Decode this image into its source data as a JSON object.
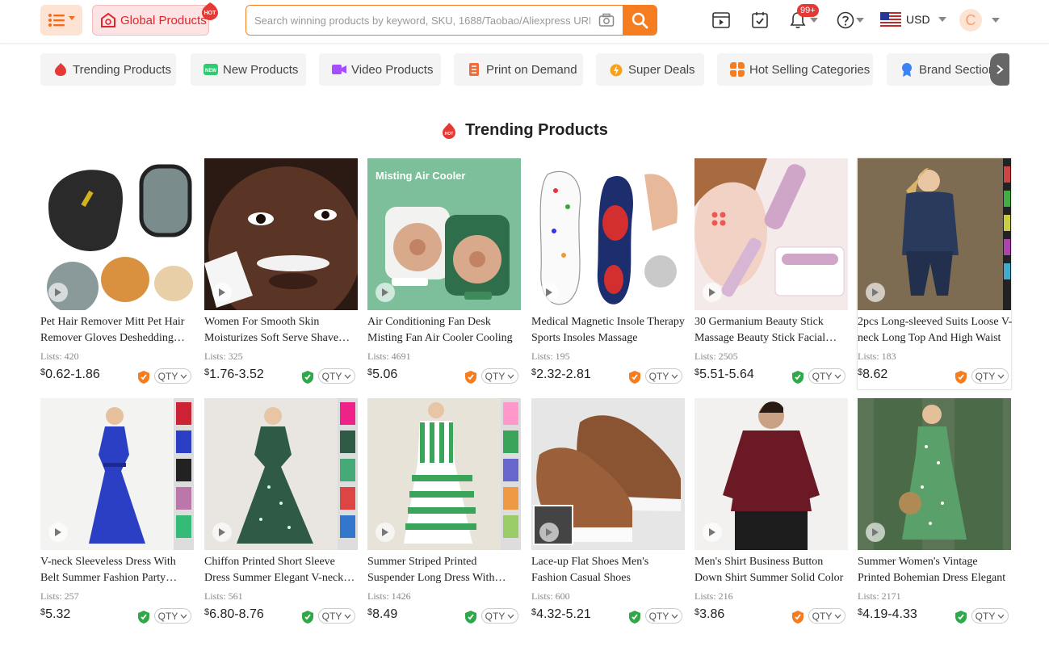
{
  "header": {
    "menu_icon": "list-menu-icon",
    "global_products_label": "Global Products",
    "hot_badge": "HOT",
    "search_placeholder": "Search winning products by keyword, SKU, 1688/Taobao/Aliexpress URL",
    "notification_count": "99+",
    "currency": "USD",
    "avatar_letter": "C",
    "accent_color": "#f57c1f"
  },
  "nav": {
    "items": [
      {
        "label": "Trending Products",
        "icon": "hot-flame-icon"
      },
      {
        "label": "New Products",
        "icon": "new-badge-icon"
      },
      {
        "label": "Video Products",
        "icon": "video-icon"
      },
      {
        "label": "Print on Demand",
        "icon": "print-icon"
      },
      {
        "label": "Super Deals",
        "icon": "deals-icon"
      },
      {
        "label": "Hot Selling Categories",
        "icon": "categories-icon"
      },
      {
        "label": "Brand Section",
        "icon": "brand-icon"
      }
    ]
  },
  "section": {
    "title": "Trending Products",
    "icon": "hot-flame-icon"
  },
  "products": [
    {
      "title": "Pet Hair Remover Mitt Pet Hair Remover Gloves Deshedding Brush",
      "lists": "Lists: 420",
      "price": "0.62-1.86",
      "shield": "orange",
      "qty": "QTY"
    },
    {
      "title": "Women For Smooth Skin Moisturizes Soft Serve Shave Cream",
      "lists": "Lists: 325",
      "price": "1.76-3.52",
      "shield": "green",
      "qty": "QTY"
    },
    {
      "title": "Air Conditioning Fan Desk Misting Fan Air Cooler Cooling",
      "lists": "Lists: 4691",
      "price": "5.06",
      "shield": "orange",
      "qty": "QTY"
    },
    {
      "title": "Medical Magnetic Insole Therapy Sports Insoles Massage",
      "lists": "Lists: 195",
      "price": "2.32-2.81",
      "shield": "orange",
      "qty": "QTY"
    },
    {
      "title": "30 Germanium Beauty Stick Massage Beauty Stick Facial Roller",
      "lists": "Lists: 2505",
      "price": "5.51-5.64",
      "shield": "green",
      "qty": "QTY"
    },
    {
      "title": "2pcs Long-sleeved Suits Loose V-neck Long Top And High Waist",
      "lists": "Lists: 183",
      "price": "8.62",
      "shield": "orange",
      "qty": "QTY"
    },
    {
      "title": "V-neck Sleeveless Dress With Belt Summer Fashion Party Clothes",
      "lists": "Lists: 257",
      "price": "5.32",
      "shield": "green",
      "qty": "QTY"
    },
    {
      "title": "Chiffon Printed Short Sleeve Dress Summer Elegant V-neck Dress",
      "lists": "Lists: 561",
      "price": "6.80-8.76",
      "shield": "green",
      "qty": "QTY"
    },
    {
      "title": "Summer Striped Printed Suspender Long Dress With Ruffles",
      "lists": "Lists: 1426",
      "price": "8.49",
      "shield": "green",
      "qty": "QTY"
    },
    {
      "title": "Lace-up Flat Shoes Men's Fashion Casual Shoes",
      "lists": "Lists: 600",
      "price": "4.32-5.21",
      "shield": "green",
      "qty": "QTY"
    },
    {
      "title": "Men's Shirt Business Button Down Shirt Summer Solid Color",
      "lists": "Lists: 216",
      "price": "3.86",
      "shield": "orange",
      "qty": "QTY"
    },
    {
      "title": "Summer Women's Vintage Printed Bohemian Dress Elegant",
      "lists": "Lists: 2171",
      "price": "4.19-4.33",
      "shield": "green",
      "qty": "QTY"
    }
  ],
  "currency_symbol": "$"
}
